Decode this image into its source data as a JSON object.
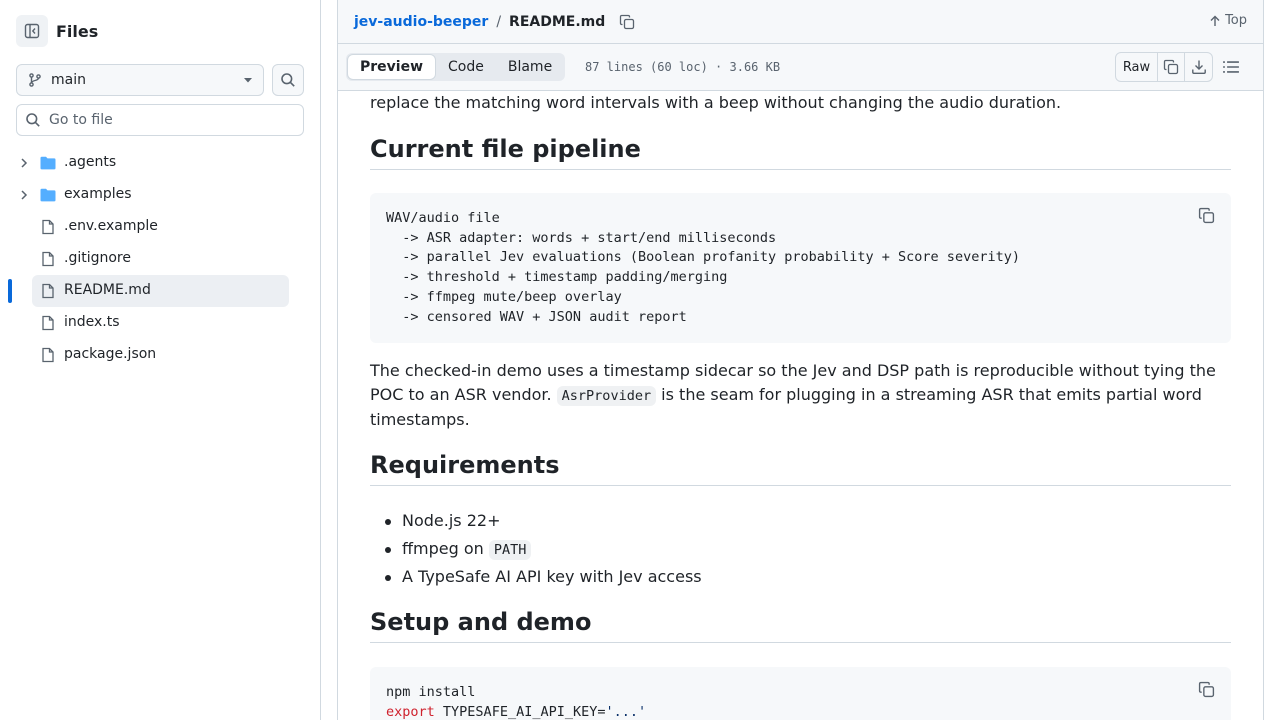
{
  "sidebar": {
    "title": "Files",
    "branch": "main",
    "goto_placeholder": "Go to file",
    "items": [
      {
        "name": ".agents",
        "type": "folder"
      },
      {
        "name": "examples",
        "type": "folder"
      },
      {
        "name": ".env.example",
        "type": "file"
      },
      {
        "name": ".gitignore",
        "type": "file"
      },
      {
        "name": "README.md",
        "type": "file",
        "selected": true
      },
      {
        "name": "index.ts",
        "type": "file"
      },
      {
        "name": "package.json",
        "type": "file"
      }
    ]
  },
  "header": {
    "repo": "jev-audio-beeper",
    "separator": "/",
    "file": "README.md",
    "top_label": "Top"
  },
  "filebar": {
    "tabs": [
      "Preview",
      "Code",
      "Blame"
    ],
    "active_tab": "Preview",
    "info": "87 lines (60 loc) · 3.66 KB",
    "raw_label": "Raw"
  },
  "readme": {
    "intro_tail": "replace the matching word intervals with a beep without changing the audio duration.",
    "h_pipeline": "Current file pipeline",
    "pipeline_code": [
      "WAV/audio file",
      "  -> ASR adapter: words + start/end milliseconds",
      "  -> parallel Jev evaluations (Boolean profanity probability + Score severity)",
      "  -> threshold + timestamp padding/merging",
      "  -> ffmpeg mute/beep overlay",
      "  -> censored WAV + JSON audit report"
    ],
    "demo_para": {
      "line1": "The checked-in demo uses a timestamp sidecar so the Jev and DSP path is reproducible without tying the",
      "line2_a": "POC to an ASR vendor.",
      "line2_code": "AsrProvider",
      "line2_b": "is the seam for plugging in a streaming ASR that emits partial word",
      "line3": "timestamps."
    },
    "h_requirements": "Requirements",
    "requirements": {
      "r1": "Node.js 22+",
      "r2_a": "ffmpeg on",
      "r2_code": "PATH",
      "r3": "A TypeSafe AI API key with Jev access"
    },
    "h_setup": "Setup and demo",
    "setup_code": {
      "l1": "npm install",
      "l2_kw": "export",
      "l2_var": "TYPESAFE_AI_API_KEY=",
      "l2_str": "'...'"
    }
  },
  "colors": {
    "link": "#0969da",
    "folder": "#54aeff",
    "keyword": "#cf222e",
    "string": "#0a3069",
    "selected_bar": "#0969da"
  }
}
